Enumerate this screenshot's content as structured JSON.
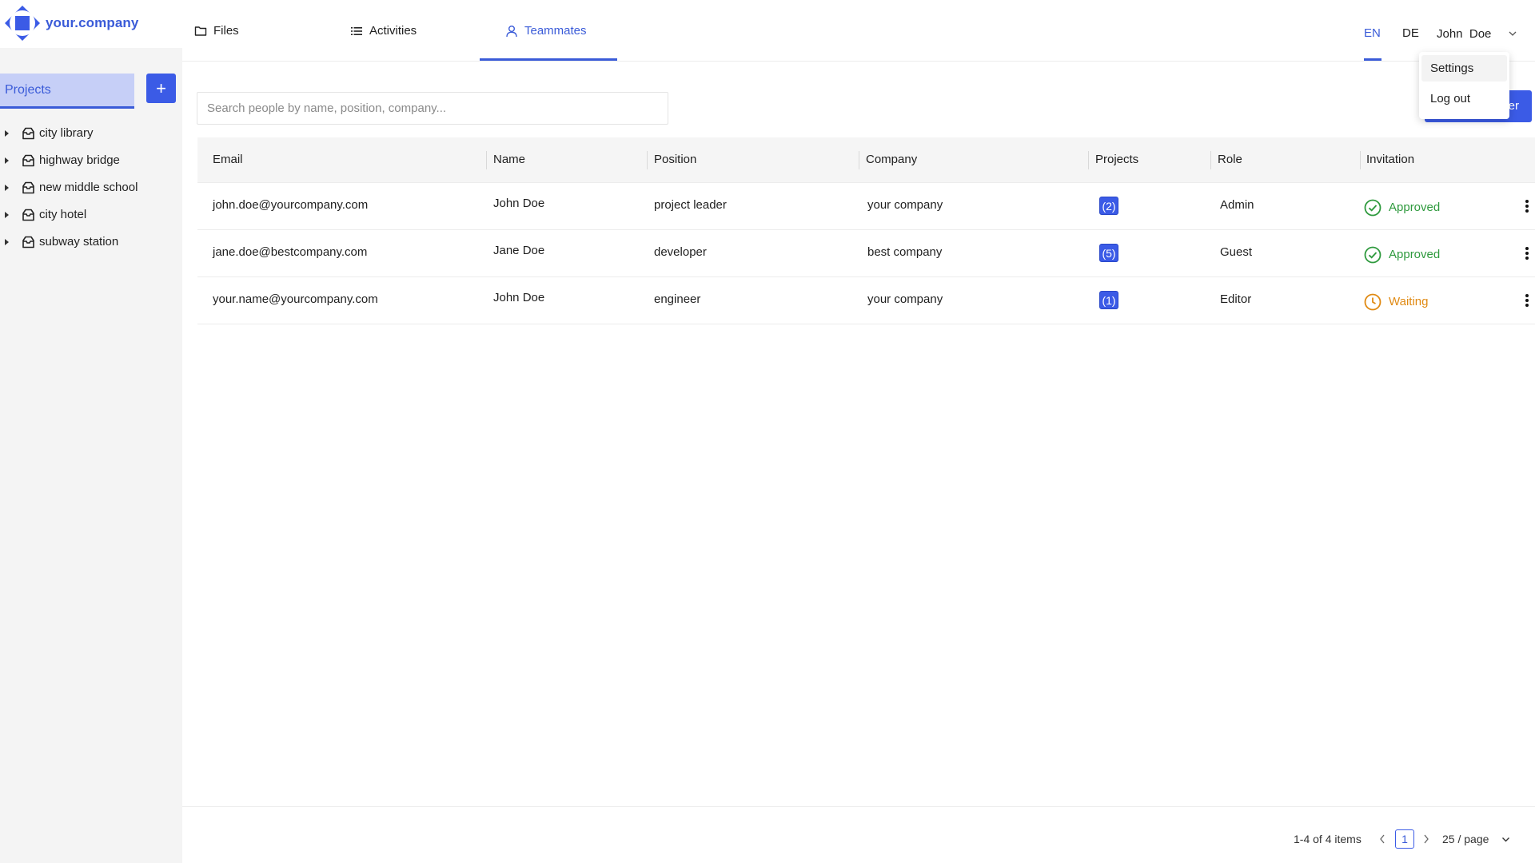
{
  "brand": {
    "name": "your.company",
    "logo_icon": "diamond-square-logo",
    "accent": "#3b5be6"
  },
  "sidebar": {
    "projects_label": "Projects",
    "add_button": "+",
    "items": [
      {
        "label": "city library",
        "icon": "inbox-icon"
      },
      {
        "label": "highway bridge",
        "icon": "inbox-icon"
      },
      {
        "label": "new middle school",
        "icon": "inbox-icon"
      },
      {
        "label": "city hotel",
        "icon": "inbox-icon"
      },
      {
        "label": "subway station",
        "icon": "inbox-icon"
      }
    ]
  },
  "nav": {
    "tabs": [
      {
        "label": "Files",
        "icon": "folder-icon"
      },
      {
        "label": "Activities",
        "icon": "list-icon"
      },
      {
        "label": "Teammates",
        "icon": "user-icon",
        "active": true
      }
    ],
    "languages": [
      {
        "label": "EN",
        "active": true
      },
      {
        "label": "DE"
      }
    ],
    "user_name": "John  Doe"
  },
  "dropdown": {
    "items": [
      "Settings",
      "Log out"
    ]
  },
  "invite_button_label": "er",
  "search": {
    "placeholder": "Search people by name, position, company..."
  },
  "table": {
    "columns": [
      "Email",
      "Name",
      "Position",
      "Company",
      "Projects",
      "Role",
      "Invitation"
    ],
    "rows": [
      {
        "email": "john.doe@yourcompany.com",
        "name": "John Doe",
        "position": "project leader",
        "company": "your company",
        "projects": "(2)",
        "role": "Admin",
        "invitation": "Approved",
        "status": "approved"
      },
      {
        "email": "jane.doe@bestcompany.com",
        "name": "Jane Doe",
        "position": "developer",
        "company": "best company",
        "projects": "(5)",
        "role": "Guest",
        "invitation": "Approved",
        "status": "approved"
      },
      {
        "email": "your.name@yourcompany.com",
        "name": "John Doe",
        "position": "engineer",
        "company": "your company",
        "projects": "(1)",
        "role": "Editor",
        "invitation": "Waiting",
        "status": "waiting"
      }
    ]
  },
  "pagination": {
    "range": "1-4 of 4 items",
    "current_page": "1",
    "page_size": "25 / page"
  },
  "colors": {
    "approved": "#2f9a3e",
    "waiting": "#e08a13",
    "active": "#3a5bd8"
  }
}
